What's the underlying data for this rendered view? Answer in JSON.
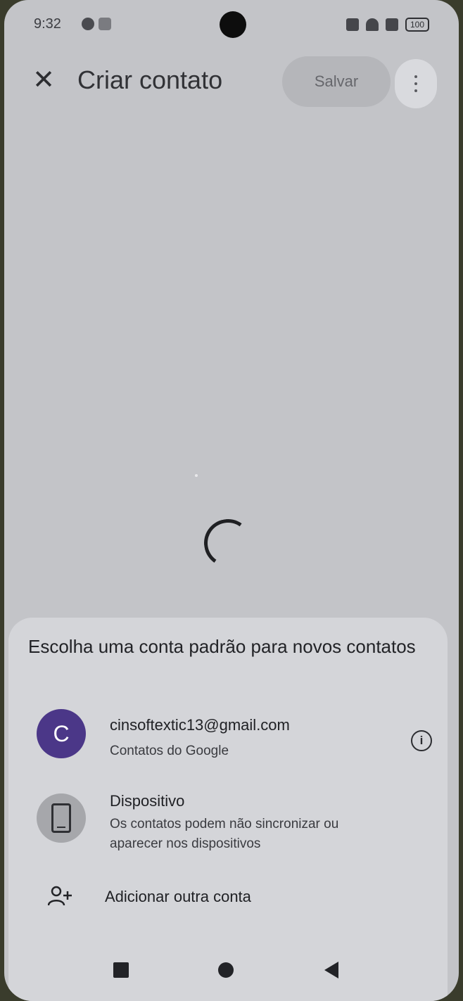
{
  "status_bar": {
    "time": "9:32",
    "battery": "100"
  },
  "top_bar": {
    "title": "Criar contato",
    "save_label": "Salvar",
    "close_symbol": "✕"
  },
  "sheet": {
    "title": "Escolha uma conta padrão para novos contatos",
    "accounts": [
      {
        "avatar_letter": "C",
        "email": "cinsoftextic13@gmail.com",
        "subtitle": "Contatos do Google"
      },
      {
        "name": "Dispositivo",
        "subtitle": "Os contatos podem não sincronizar ou aparecer nos dispositivos"
      }
    ],
    "add_account_label": "Adicionar outra conta",
    "info_symbol": "i"
  },
  "icons": {
    "close": "close-icon",
    "menu": "more-vert-icon",
    "info": "info-icon",
    "device": "smartphone-icon",
    "add_person": "person-add-icon",
    "recents": "recents-icon",
    "home": "home-icon",
    "back": "back-icon"
  },
  "colors": {
    "screen_bg": "#c3c4c8",
    "sheet_bg": "#d4d5d9",
    "avatar_purple": "#4b3788",
    "text_dark": "#1f2024"
  }
}
